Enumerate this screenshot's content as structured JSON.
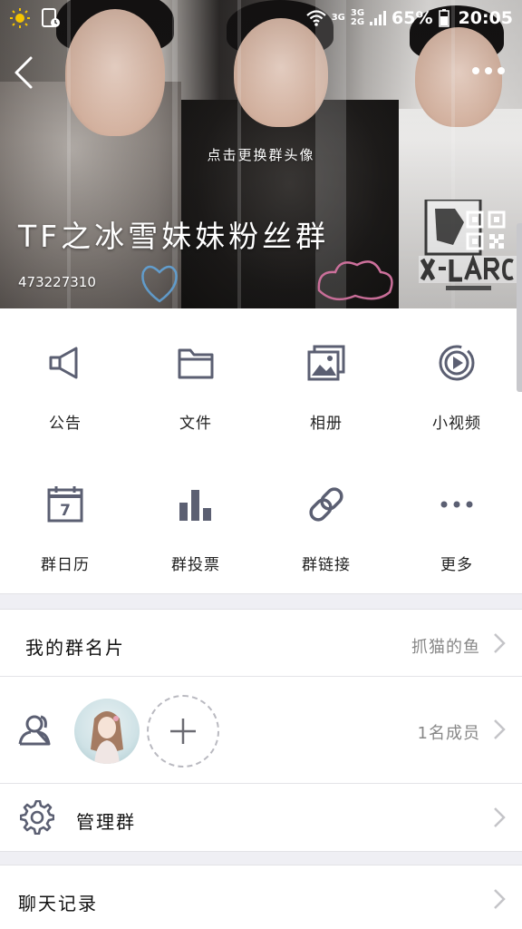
{
  "status_bar": {
    "net1": "3G",
    "net2_top": "3G",
    "net2_bottom": "2G",
    "battery": "65%",
    "time": "20:05"
  },
  "header": {
    "change_avatar_hint": "点击更换群头像",
    "group_name": "TF之冰雪妹妹粉丝群",
    "group_id": "473227310",
    "icons": [
      "back-icon",
      "more-icon",
      "qr-code-icon"
    ]
  },
  "features": [
    {
      "label": "公告",
      "icon": "megaphone-icon"
    },
    {
      "label": "文件",
      "icon": "folder-icon"
    },
    {
      "label": "相册",
      "icon": "album-icon"
    },
    {
      "label": "小视频",
      "icon": "video-icon"
    },
    {
      "label": "群日历",
      "icon": "calendar-icon"
    },
    {
      "label": "群投票",
      "icon": "vote-icon"
    },
    {
      "label": "群链接",
      "icon": "link-icon"
    },
    {
      "label": "更多",
      "icon": "more-dots-icon"
    }
  ],
  "calendar_day": "7",
  "card": {
    "label": "我的群名片",
    "value": "抓猫的鱼"
  },
  "members": {
    "count_label": "1名成员",
    "icon": "members-icon"
  },
  "manage": {
    "label": "管理群",
    "icon": "gear-icon"
  },
  "chat_history": {
    "label": "聊天记录"
  },
  "colors": {
    "icon": "#5b5f72",
    "chevron": "#c4c4c8",
    "gap": "#efeff4"
  }
}
